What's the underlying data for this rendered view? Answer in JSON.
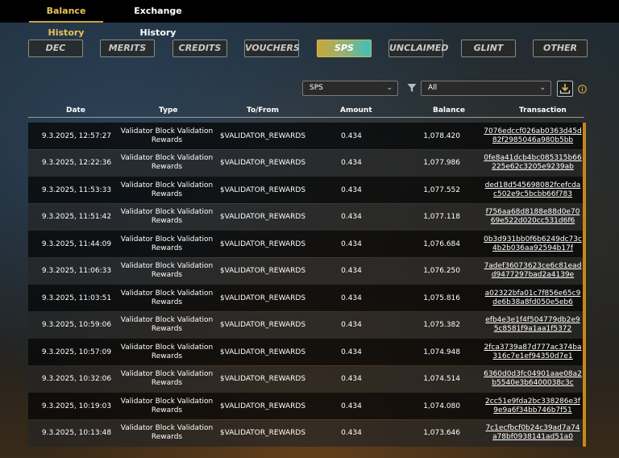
{
  "tabs": [
    {
      "label": "Balance History",
      "active": true
    },
    {
      "label": "Exchange History",
      "active": false
    }
  ],
  "tokens": [
    {
      "label": "DEC"
    },
    {
      "label": "MERITS"
    },
    {
      "label": "CREDITS"
    },
    {
      "label": "VOUCHERS"
    },
    {
      "label": "SPS",
      "active": true
    },
    {
      "label": "UNCLAIMED"
    },
    {
      "label": "GLINT"
    },
    {
      "label": "OTHER"
    }
  ],
  "filters": {
    "token_select": "SPS",
    "type_select": "All",
    "filter_icon": "filter-icon",
    "download_icon": "download-icon",
    "info_icon": "info-icon"
  },
  "colors": {
    "accent_gold": "#c9a23c",
    "active_gradient_start": "#c9a93a",
    "active_gradient_end": "#3dc0bf",
    "scrollbar": "#c8861a"
  },
  "table": {
    "headers": [
      "Date",
      "Type",
      "To/From",
      "Amount",
      "Balance",
      "Transaction"
    ],
    "rows": [
      {
        "date": "9.3.2025, 12:57:27",
        "type": "Validator Block Validation Rewards",
        "from": "$VALIDATOR_REWARDS",
        "amount": "0.434",
        "balance": "1,078.420",
        "tx": "7076edccf026ab0363d45d82f2985046a980b5bb"
      },
      {
        "date": "9.3.2025, 12:22:36",
        "type": "Validator Block Validation Rewards",
        "from": "$VALIDATOR_REWARDS",
        "amount": "0.434",
        "balance": "1,077.986",
        "tx": "0fe8a41dcb4bc085315b66225e62c3205e9239ab"
      },
      {
        "date": "9.3.2025, 11:53:33",
        "type": "Validator Block Validation Rewards",
        "from": "$VALIDATOR_REWARDS",
        "amount": "0.434",
        "balance": "1,077.552",
        "tx": "ded18d545698082fcefcdac502e9c5bcbb66f783"
      },
      {
        "date": "9.3.2025, 11:51:42",
        "type": "Validator Block Validation Rewards",
        "from": "$VALIDATOR_REWARDS",
        "amount": "0.434",
        "balance": "1,077.118",
        "tx": "f756aa68d8188e88d0e7069e522d020cc531d6f6"
      },
      {
        "date": "9.3.2025, 11:44:09",
        "type": "Validator Block Validation Rewards",
        "from": "$VALIDATOR_REWARDS",
        "amount": "0.434",
        "balance": "1,076.684",
        "tx": "0b3d931bb0f6b6249dc73c4b2b036aa92594b17f"
      },
      {
        "date": "9.3.2025, 11:06:33",
        "type": "Validator Block Validation Rewards",
        "from": "$VALIDATOR_REWARDS",
        "amount": "0.434",
        "balance": "1,076.250",
        "tx": "7adef36073623ce6c81eadd9477297bad2a4139e"
      },
      {
        "date": "9.3.2025, 11:03:51",
        "type": "Validator Block Validation Rewards",
        "from": "$VALIDATOR_REWARDS",
        "amount": "0.434",
        "balance": "1,075.816",
        "tx": "a02322bfa01c7f856e65c9de6b38a8fd050e5eb6"
      },
      {
        "date": "9.3.2025, 10:59:06",
        "type": "Validator Block Validation Rewards",
        "from": "$VALIDATOR_REWARDS",
        "amount": "0.434",
        "balance": "1,075.382",
        "tx": "efb4e3e1f4f504779db2e95c8581f9a1aa1f5372"
      },
      {
        "date": "9.3.2025, 10:57:09",
        "type": "Validator Block Validation Rewards",
        "from": "$VALIDATOR_REWARDS",
        "amount": "0.434",
        "balance": "1,074.948",
        "tx": "2fca3739a87d777ac374ba316c7e1ef94350d7e1"
      },
      {
        "date": "9.3.2025, 10:32:06",
        "type": "Validator Block Validation Rewards",
        "from": "$VALIDATOR_REWARDS",
        "amount": "0.434",
        "balance": "1,074.514",
        "tx": "6360d0d3fc04901aae08a2b5540e3b6400038c3c"
      },
      {
        "date": "9.3.2025, 10:19:03",
        "type": "Validator Block Validation Rewards",
        "from": "$VALIDATOR_REWARDS",
        "amount": "0.434",
        "balance": "1,074.080",
        "tx": "2cc51e9fda2bc338286e3f9e9a6f34bb746b7f51"
      },
      {
        "date": "9.3.2025, 10:13:48",
        "type": "Validator Block Validation Rewards",
        "from": "$VALIDATOR_REWARDS",
        "amount": "0.434",
        "balance": "1,073.646",
        "tx": "7c1ecfbcf0b24c39ad7a74a78bf0938141ad51a0"
      }
    ]
  }
}
